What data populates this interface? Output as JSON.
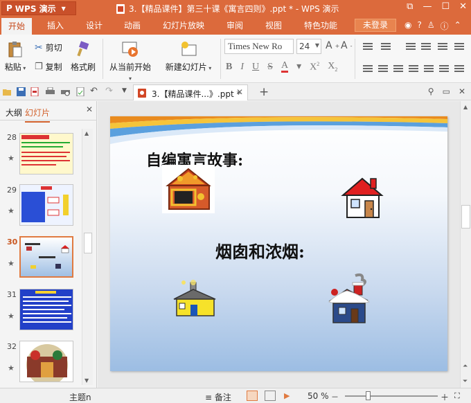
{
  "titlebar": {
    "app_button": "WPS 演示",
    "doc_title": "3.【精品课件】第三十课《寓言四则》.ppt * - WPS 演示"
  },
  "menubar": {
    "items": [
      "开始",
      "插入",
      "设计",
      "动画",
      "幻灯片放映",
      "审阅",
      "视图",
      "特色功能"
    ],
    "login": "未登录"
  },
  "ribbon": {
    "paste": "粘贴",
    "cut": "剪切",
    "copy": "复制",
    "format_painter": "格式刷",
    "from_current": "从当前开始",
    "new_slide": "新建幻灯片",
    "font_name": "Times New Ro",
    "font_size": "24"
  },
  "tabs": {
    "doc_tab": "3.【精品课件...》.ppt *"
  },
  "panel": {
    "tab_outline": "大纲",
    "tab_slides": "幻灯片",
    "slides": [
      {
        "num": "28",
        "star": "★"
      },
      {
        "num": "29",
        "star": "★"
      },
      {
        "num": "30",
        "star": "★"
      },
      {
        "num": "31",
        "star": "★"
      },
      {
        "num": "32",
        "star": "★"
      }
    ]
  },
  "slide": {
    "text1": "自编寓言故事:",
    "text2": "烟囱和浓烟:"
  },
  "status": {
    "theme": "主题n",
    "notes": "备注",
    "zoom": "50 %"
  }
}
